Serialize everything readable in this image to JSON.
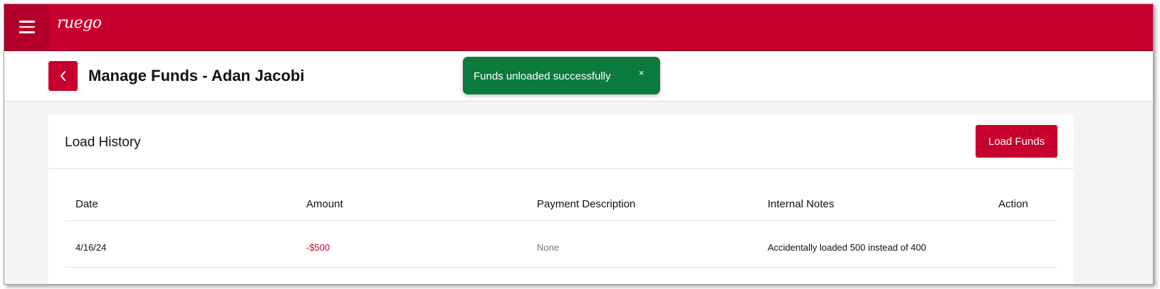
{
  "app": {
    "logo": "ruego"
  },
  "header": {
    "title": "Manage Funds - Adan Jacobi"
  },
  "toast": {
    "message": "Funds unloaded successfully",
    "close": "×",
    "color": "#0b7a3c"
  },
  "card": {
    "title": "Load History",
    "load_button": "Load Funds",
    "columns": [
      "Date",
      "Amount",
      "Payment Description",
      "Internal Notes",
      "Action"
    ],
    "rows": [
      {
        "date": "4/16/24",
        "amount": "-$500",
        "description": "None",
        "notes": "Accidentally loaded 500 instead of 400",
        "action": ""
      }
    ]
  },
  "colors": {
    "brand": "#c8002f",
    "amount_negative": "#c8002f",
    "muted": "#777777"
  }
}
